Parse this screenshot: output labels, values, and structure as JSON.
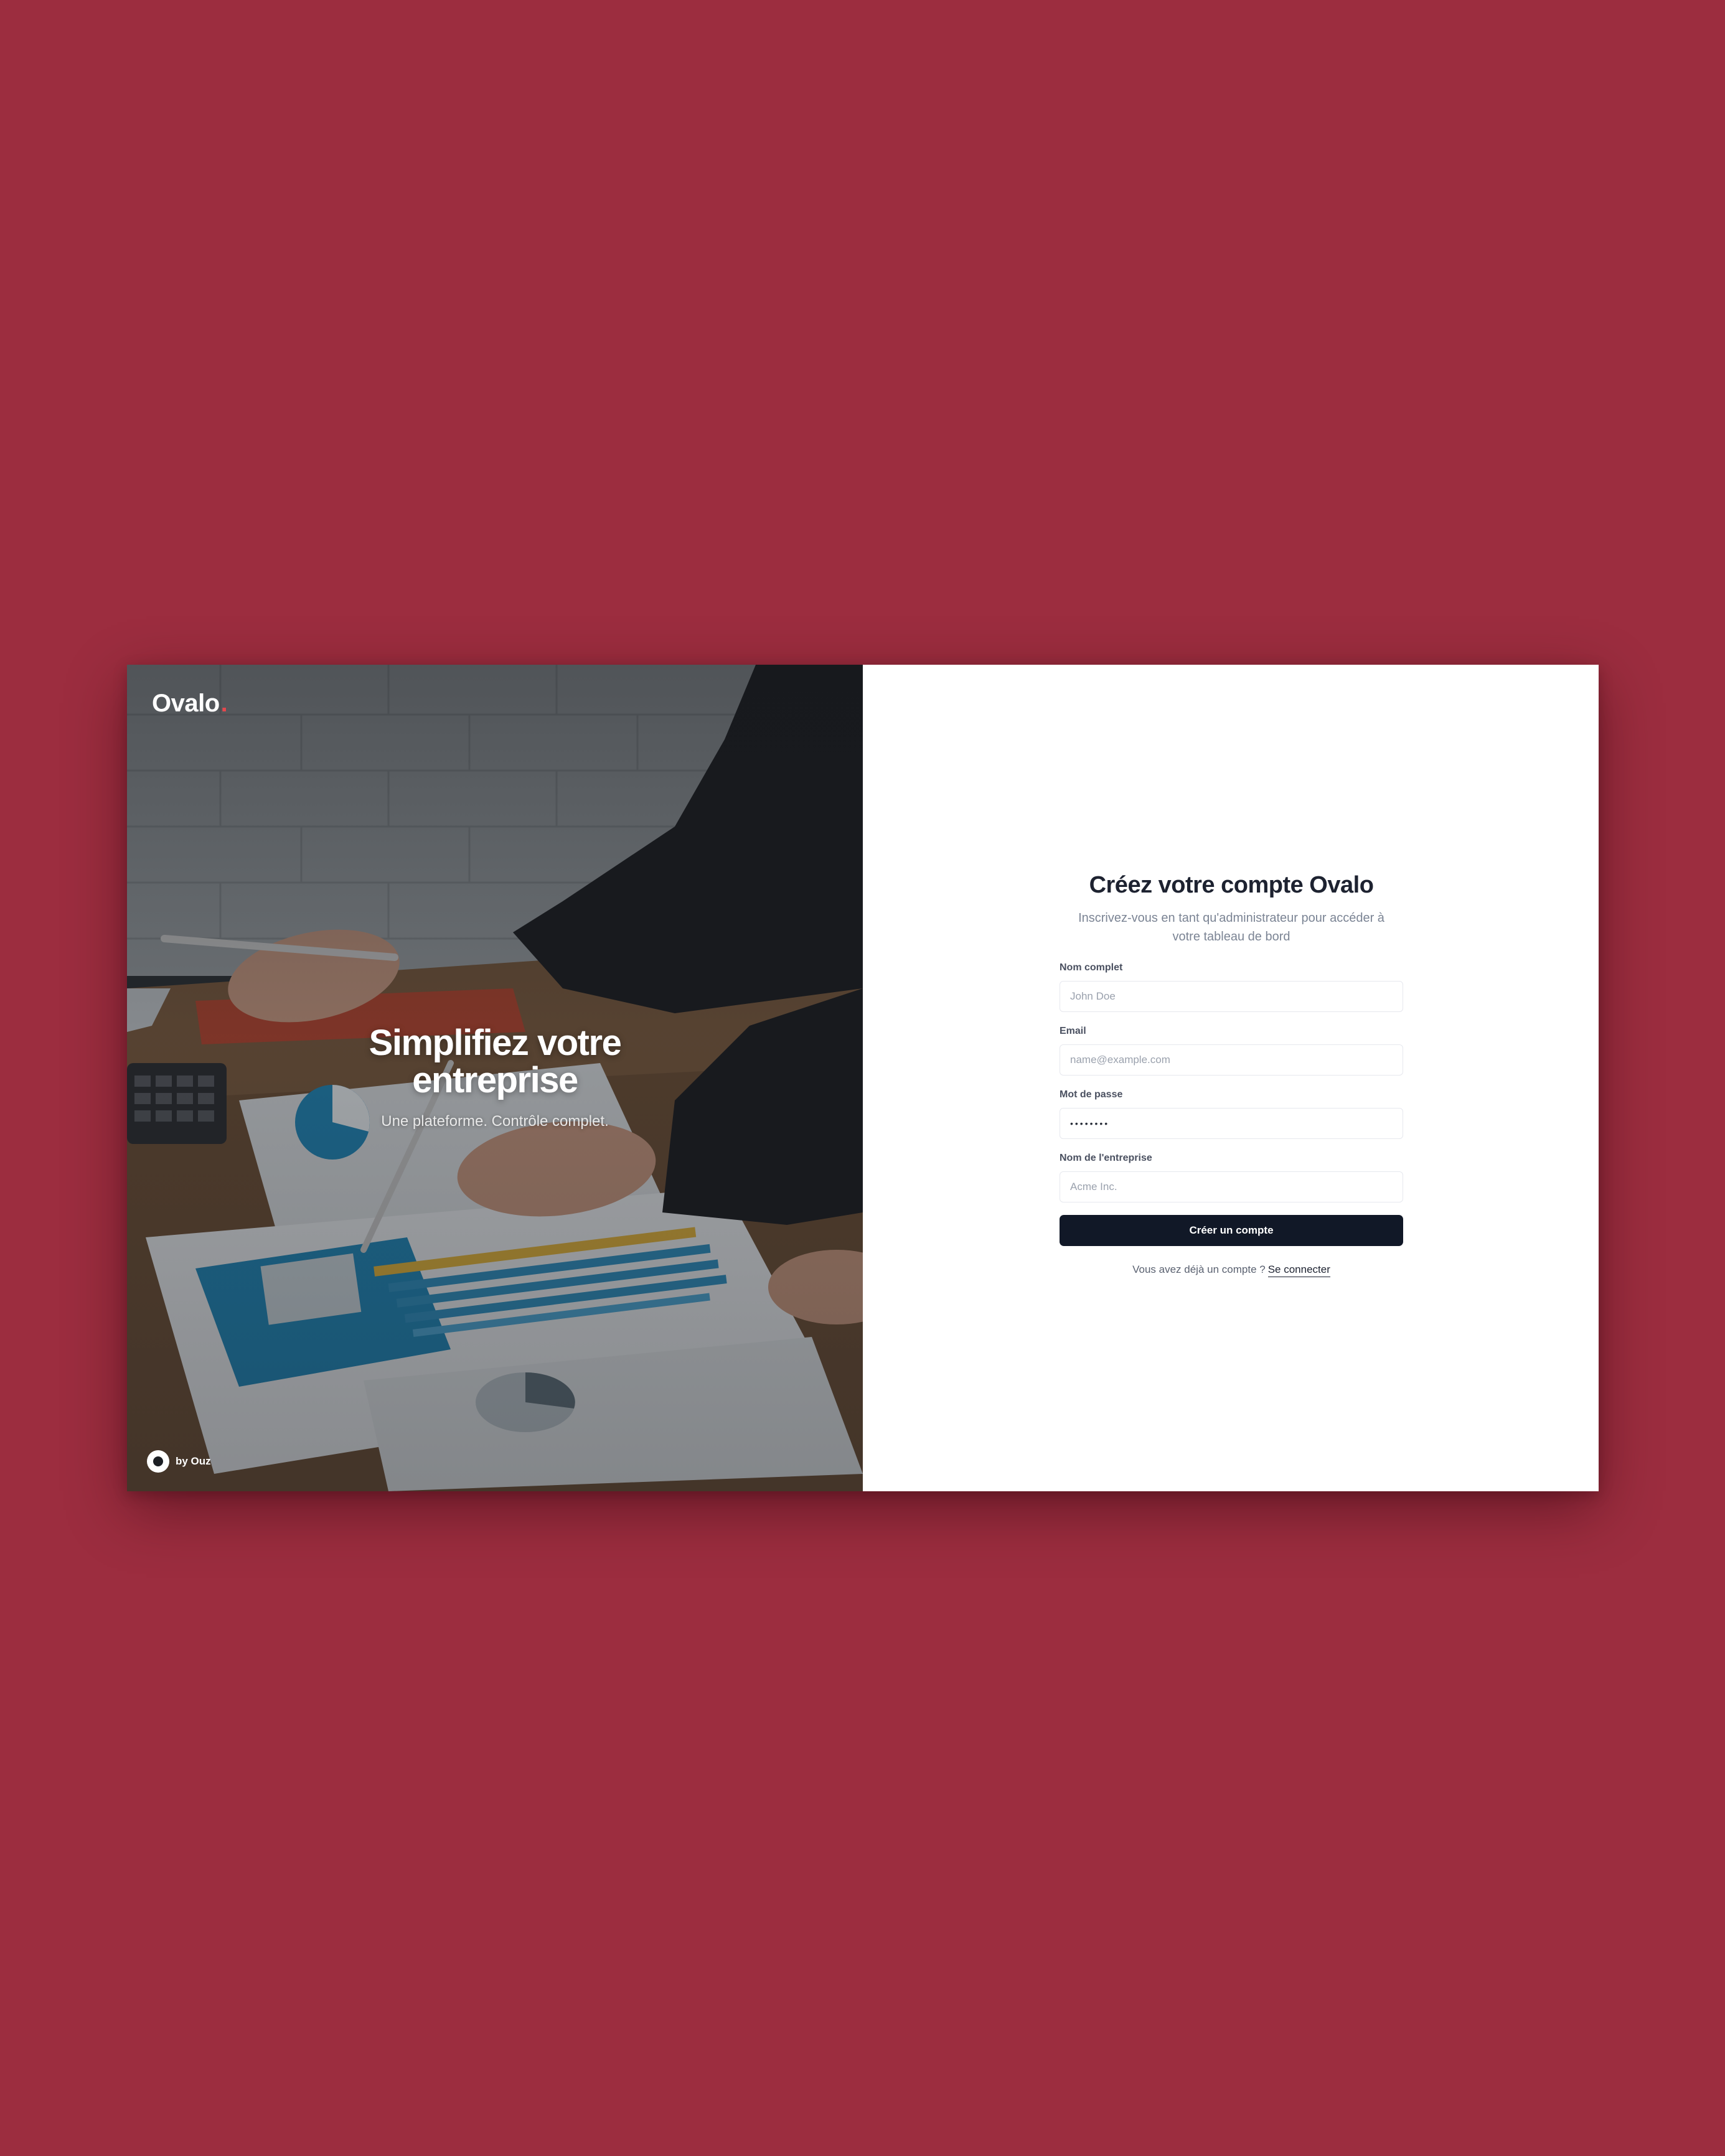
{
  "brand": {
    "name": "Ovalo",
    "accent": "."
  },
  "hero": {
    "title": "Simplifiez votre entreprise",
    "subtitle": "Une plateforme. Contrôle complet.",
    "byline": "by Ouz"
  },
  "form": {
    "title": "Créez votre compte Ovalo",
    "subtitle": "Inscrivez-vous en tant qu'administrateur pour accéder à votre tableau de bord",
    "fields": [
      {
        "label": "Nom complet",
        "placeholder": "John Doe",
        "value": ""
      },
      {
        "label": "Email",
        "placeholder": "name@example.com",
        "value": ""
      },
      {
        "label": "Mot de passe",
        "placeholder": "",
        "value": "••••••••"
      },
      {
        "label": "Nom de l'entreprise",
        "placeholder": "Acme Inc.",
        "value": ""
      }
    ],
    "submit_label": "Créer un compte",
    "signin_prompt": "Vous avez déjà un compte ?",
    "signin_link": "Se connecter"
  },
  "colors": {
    "page_background": "#9c2d3f",
    "button": "#111827",
    "brand_accent": "#e5484d"
  }
}
